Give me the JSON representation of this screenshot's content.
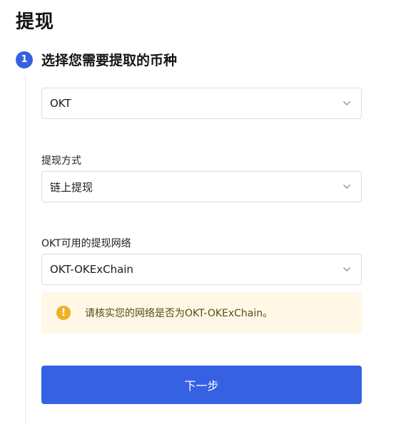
{
  "page": {
    "title": "提现"
  },
  "step": {
    "number": "1",
    "title": "选择您需要提取的币种"
  },
  "coin_select": {
    "value": "OKT",
    "icon": "chevron-down-icon"
  },
  "method": {
    "label": "提现方式",
    "value": "链上提现",
    "icon": "chevron-down-icon"
  },
  "network": {
    "label": "OKT可用的提现网络",
    "value": "OKT-OKExChain",
    "icon": "chevron-down-icon"
  },
  "alert": {
    "icon": "warning-icon",
    "symbol": "!",
    "text": "请核实您的网络是否为OKT-OKExChain。",
    "bg_color": "#fff8e6",
    "icon_color": "#efb126"
  },
  "actions": {
    "next_label": "下一步",
    "color": "#3661e3"
  }
}
